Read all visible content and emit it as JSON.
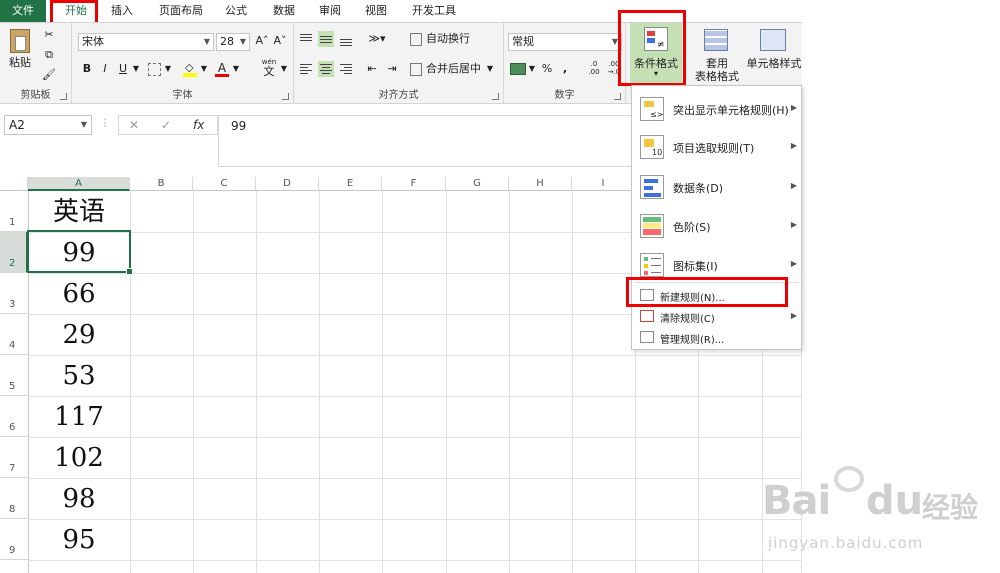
{
  "tabs": [
    "文件",
    "开始",
    "插入",
    "页面布局",
    "公式",
    "数据",
    "审阅",
    "视图",
    "开发工具"
  ],
  "ribbon": {
    "clipboard": {
      "label": "剪贴板",
      "paste": "粘贴"
    },
    "font": {
      "label": "字体",
      "name": "宋体",
      "size": "28",
      "bold": "B",
      "italic": "I",
      "underline": "U",
      "grow": "A˄",
      "shrink": "A˅",
      "font_color": "A",
      "phonetic_top": "wén",
      "phonetic": "文"
    },
    "alignment": {
      "label": "对齐方式",
      "wrap": "自动换行",
      "merge": "合并后居中"
    },
    "number": {
      "label": "数字",
      "format": "常规",
      "percent": "%",
      "comma": ",",
      "inc_top": ".0",
      "inc_bottom": ".00",
      "dec_top": ".00",
      "dec_bottom": "→.0"
    },
    "styles": {
      "conditional_line1": "条件格式",
      "conditional_line2": "▾",
      "table_line1": "套用",
      "table_line2": "表格格式",
      "cell_styles": "单元格样式"
    }
  },
  "formula_bar": {
    "name_box": "A2",
    "cancel": "✕",
    "confirm": "✓",
    "fx": "fx",
    "value": "99"
  },
  "columns": [
    "A",
    "B",
    "C",
    "D",
    "E",
    "F",
    "G",
    "H",
    "I"
  ],
  "rows": [
    "1",
    "2",
    "3",
    "4",
    "5",
    "6",
    "7",
    "8",
    "9"
  ],
  "cells": [
    "英语",
    "99",
    "66",
    "29",
    "53",
    "117",
    "102",
    "98",
    "95"
  ],
  "menu": {
    "items": [
      {
        "label": "突出显示单元格规则(H)",
        "icon": "highlight-cells-icon"
      },
      {
        "label": "项目选取规则(T)",
        "icon": "top-bottom-rules-icon"
      },
      {
        "label": "数据条(D)",
        "icon": "data-bars-icon"
      },
      {
        "label": "色阶(S)",
        "icon": "color-scales-icon"
      },
      {
        "label": "图标集(I)",
        "icon": "icon-sets-icon"
      }
    ],
    "small_items": [
      {
        "label": "新建规则(N)...",
        "icon": "new-rule-icon"
      },
      {
        "label": "清除规则(C)",
        "icon": "clear-rules-icon"
      },
      {
        "label": "管理规则(R)...",
        "icon": "manage-rules-icon"
      }
    ]
  },
  "watermark": {
    "brand": "Bai",
    "paw": "du",
    "cn": "经验",
    "url": "jingyan.baidu.com"
  },
  "colors": {
    "excel_green": "#217346",
    "highlight_red": "#e00000"
  }
}
